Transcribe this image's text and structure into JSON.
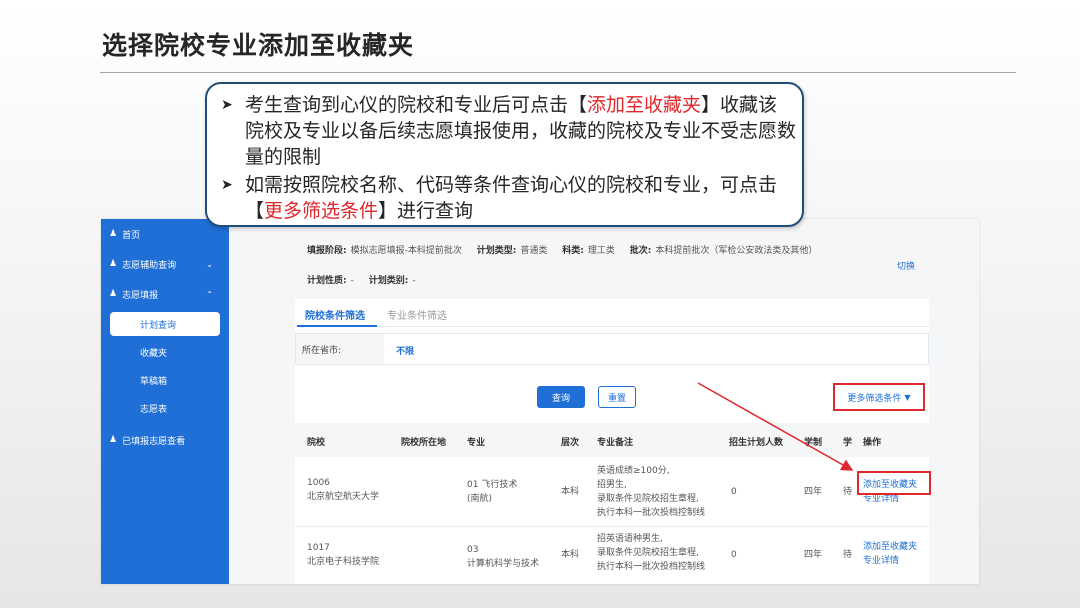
{
  "slide": {
    "title": "选择院校专业添加至收藏夹"
  },
  "callout": {
    "b1_prefix": "考生查询到心仪的院校和专业后可点击【",
    "b1_red": "添加至收藏夹",
    "b1_suffix": "】收藏该院校及专业以备后续志愿填报使用，收藏的院校及专业不受志愿数量的限制",
    "b2_prefix": "如需按照院校名称、代码等条件查询心仪的院校和专业，可点击【",
    "b2_red": "更多筛选条件",
    "b2_suffix": "】进行查询"
  },
  "sidebar": {
    "home": "首页",
    "assist": "志愿辅助查询",
    "fill": "志愿填报",
    "plan_query": "计划查询",
    "favorites": "收藏夹",
    "draft": "草稿箱",
    "volunteer_form": "志愿表",
    "filled_view": "已填报志愿查看"
  },
  "info": {
    "stage_label": "填报阶段:",
    "stage_value": "模拟志愿填报-本科提前批次",
    "plan_type_label": "计划类型:",
    "plan_type_value": "普通类",
    "subject_label": "科类:",
    "subject_value": "理工类",
    "batch_label": "批次:",
    "batch_value": "本科提前批次（军检公安政法类及其他）",
    "nature_label": "计划性质:",
    "nature_value": "-",
    "category_label": "计划类别:",
    "category_value": "-",
    "switch": "切换"
  },
  "tabs": {
    "school": "院校条件筛选",
    "major": "专业条件筛选"
  },
  "filter": {
    "province_label": "所在省市:",
    "province_value": "不限"
  },
  "buttons": {
    "query": "查询",
    "reset": "重置",
    "more_filter": "更多筛选条件"
  },
  "table": {
    "headers": [
      "院校",
      "院校所在地",
      "专业",
      "层次",
      "专业备注",
      "招生计划人数",
      "学制",
      "学",
      "操作"
    ],
    "rows": [
      {
        "code": "1006",
        "school": "北京航空航天大学",
        "location": "",
        "major_code": "01 飞行技术",
        "major_name": "(南航)",
        "level": "本科",
        "note1": "英语成绩≥100分,",
        "note2": "招男生,",
        "note3": "录取条件见院校招生章程,",
        "note4": "执行本科一批次投档控制线",
        "plan": "0",
        "years": "四年",
        "fee": "待",
        "add": "添加至收藏夹",
        "detail": "专业详情"
      },
      {
        "code": "1017",
        "school": "北京电子科技学院",
        "location": "",
        "major_code": "03",
        "major_name": "计算机科学与技术",
        "level": "本科",
        "note1": "招英语语种男生,",
        "note2": "录取条件见院校招生章程,",
        "note3": "执行本科一批次投档控制线",
        "note4": "",
        "plan": "0",
        "years": "四年",
        "fee": "待",
        "add": "添加至收藏夹",
        "detail": "专业详情"
      }
    ]
  },
  "colors": {
    "accent": "#1f6fd6",
    "highlight": "#e0272c",
    "callout_border": "#1f4e79"
  }
}
